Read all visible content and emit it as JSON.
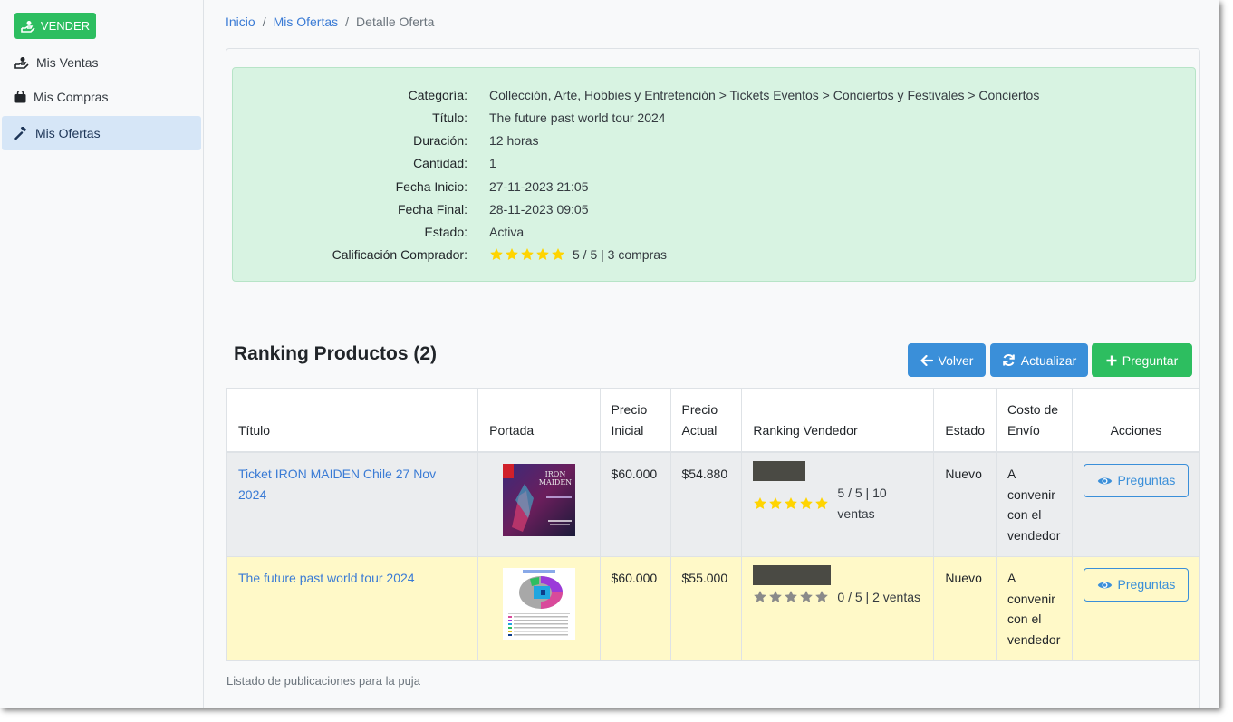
{
  "sidebar": {
    "vender_label": "VENDER",
    "items": [
      {
        "label": "Mis Ventas",
        "icon": "hand-coin-icon"
      },
      {
        "label": "Mis Compras",
        "icon": "shopping-bag-icon"
      },
      {
        "label": "Mis Ofertas",
        "icon": "gavel-icon"
      }
    ]
  },
  "breadcrumb": {
    "items": [
      "Inicio",
      "Mis Ofertas",
      "Detalle Oferta"
    ],
    "separator": "/"
  },
  "info": {
    "rows": [
      {
        "label": "Categoría:",
        "value": "Collección, Arte, Hobbies y Entretención > Tickets Eventos > Conciertos y Festivales > Conciertos"
      },
      {
        "label": "Título:",
        "value": "The future past world tour 2024"
      },
      {
        "label": "Duración:",
        "value": "12 horas"
      },
      {
        "label": "Cantidad:",
        "value": "1"
      },
      {
        "label": "Fecha Inicio:",
        "value": "27-11-2023 21:05"
      },
      {
        "label": "Fecha Final:",
        "value": "28-11-2023 09:05"
      },
      {
        "label": "Estado:",
        "value": "Activa"
      },
      {
        "label": "Calificación Comprador:",
        "value": "5 / 5 | 3 compras",
        "stars": 5
      }
    ]
  },
  "ranking": {
    "title": "Ranking Productos (2)",
    "buttons": {
      "volver": "Volver",
      "actualizar": "Actualizar",
      "preguntar": "Preguntar"
    },
    "headers": {
      "titulo": "Título",
      "portada": "Portada",
      "precio_inicial_1": "Precio",
      "precio_inicial_2": "Inicial",
      "precio_actual_1": "Precio",
      "precio_actual_2": "Actual",
      "ranking_vendedor": "Ranking Vendedor",
      "estado": "Estado",
      "costo_1": "Costo de",
      "costo_2": "Envío",
      "acciones": "Acciones"
    },
    "rows": [
      {
        "title": "Ticket IRON MAIDEN Chile 27 Nov 2024",
        "precio_inicial": "$60.000",
        "precio_actual": "$54.880",
        "stars": 5,
        "rating": "5 / 5 | 10 ventas",
        "estado": "Nuevo",
        "costo": [
          "A",
          "convenir",
          "con el",
          "vendedor"
        ],
        "action": "Preguntas"
      },
      {
        "title": "The future past world tour 2024",
        "precio_inicial": "$60.000",
        "precio_actual": "$55.000",
        "stars": 0,
        "rating": "0 / 5 | 2 ventas",
        "estado": "Nuevo",
        "costo": [
          "A",
          "convenir",
          "con el",
          "vendedor"
        ],
        "action": "Preguntas"
      }
    ],
    "footnote": "Listado de publicaciones para la puja"
  },
  "colors": {
    "green": "#2dbe60",
    "blue": "#3a8fd9",
    "info_bg": "#d8f3e2",
    "row_highlight": "#fff9c8",
    "star_gold": "#ffd400",
    "star_grey": "#8a8a8a"
  }
}
